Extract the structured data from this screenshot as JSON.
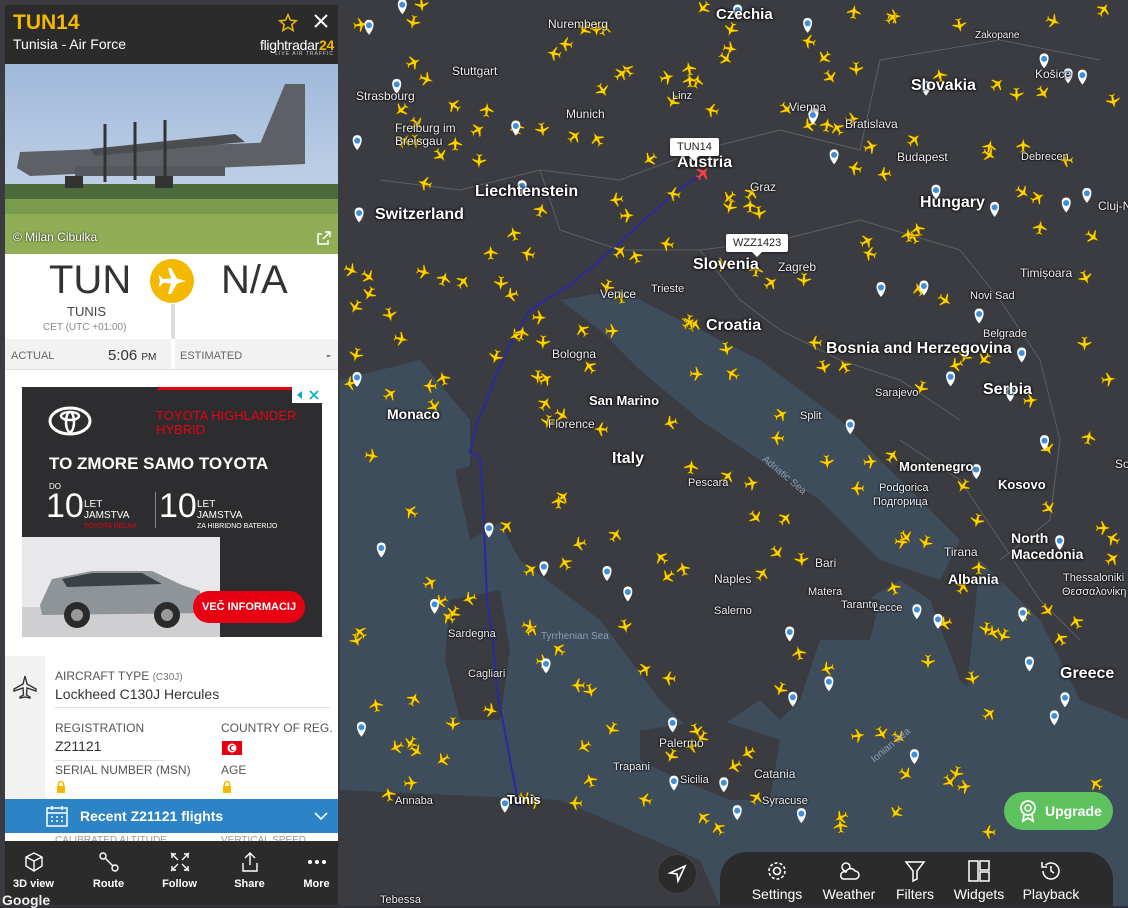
{
  "flight": {
    "callsign": "TUN14",
    "operator": "Tunisia - Air Force",
    "brand": "flightradar",
    "brand_num": "24",
    "brand_sub": "LIVE AIR TRAFFIC",
    "photo_credit": "© Milan Cibulka"
  },
  "route": {
    "from_code": "TUN",
    "from_city": "TUNIS",
    "from_tz": "CET (UTC +01:00)",
    "to_code": "N/A"
  },
  "times": {
    "actual_label": "ACTUAL",
    "actual_time": "5:06",
    "actual_ampm": "PM",
    "estimated_label": "ESTIMATED",
    "estimated_value": "-"
  },
  "ad": {
    "brand_line": "TOYOTA HIGHLANDER HYBRID",
    "headline": "TO ZMORE SAMO TOYOTA",
    "do": "DO",
    "ten_a": "10",
    "let_a": "LET JAMSTVA",
    "sub_a": "TOYOTA RELAX",
    "ten_b": "10",
    "let_b": "LET JAMSTVA",
    "sub_b": "ZA HIBRIDNO BATERIJO",
    "cta": "VEČ INFORMACIJ"
  },
  "aircraft": {
    "type_label": "AIRCRAFT TYPE",
    "type_code": "(C30J)",
    "type_value": "Lockheed C130J Hercules",
    "reg_label": "REGISTRATION",
    "reg_value": "Z21121",
    "country_label": "COUNTRY OF REG.",
    "serial_label": "SERIAL NUMBER (MSN)",
    "age_label": "AGE"
  },
  "recent": {
    "label": "Recent Z21121 flights",
    "cut_left": "CALIBRATED ALTITUDE",
    "cut_right": "VERTICAL SPEED"
  },
  "panel_toolbar": [
    "3D view",
    "Route",
    "Follow",
    "Share",
    "More"
  ],
  "map_toolbar": [
    "Settings",
    "Weather",
    "Filters",
    "Widgets",
    "Playback"
  ],
  "upgrade": "Upgrade",
  "google": "Google",
  "map_labels": {
    "callout_main": "TUN14",
    "callout_other": "WZZ1423",
    "countries": [
      "Czechia",
      "Slovakia",
      "Austria",
      "Hungary",
      "Liechtenstein",
      "Switzerland",
      "Slovenia",
      "Croatia",
      "Bosnia and Herzegovina",
      "Serbia",
      "Italy",
      "San Marino",
      "Montenegro",
      "Kosovo",
      "Albania",
      "North Macedonia",
      "Greece",
      "Monaco",
      "Tunis"
    ],
    "cities": [
      "Nuremberg",
      "Stuttgart",
      "Strasbourg",
      "Munich",
      "Freiburg im Breisgau",
      "Vienna",
      "Bratislava",
      "Budapest",
      "Košice",
      "Debrecen",
      "Cluj-Napoca",
      "Graz",
      "Zagreb",
      "Venice",
      "Trieste",
      "Bologna",
      "Florence",
      "Pescara",
      "Naples",
      "Salerno",
      "Bari",
      "Matera",
      "Taranto",
      "Lecce",
      "Sarajevo",
      "Split",
      "Podgorica",
      "Подгорица",
      "Tirana",
      "Thessaloniki",
      "Θεσσαλονίκη",
      "Palermo",
      "Trapani",
      "Sicilia",
      "Catania",
      "Syracuse",
      "Annaba",
      "Tebessa",
      "Timișoara",
      "Novi Sad",
      "Belgrade",
      "Sofia",
      "Sardegna",
      "Cagliari",
      "Zakopane",
      "Linz"
    ],
    "seas": [
      "Tyrrhenian Sea",
      "Adriatic Sea",
      "Ionian Sea"
    ]
  },
  "colors": {
    "accent": "#f5b800",
    "panel_dark": "#2b2b2b",
    "recent_blue": "#2c84c6",
    "upgrade_green": "#5ec25e",
    "track": "#2a2aa0",
    "aircraft_yellow": "#ffd200"
  }
}
